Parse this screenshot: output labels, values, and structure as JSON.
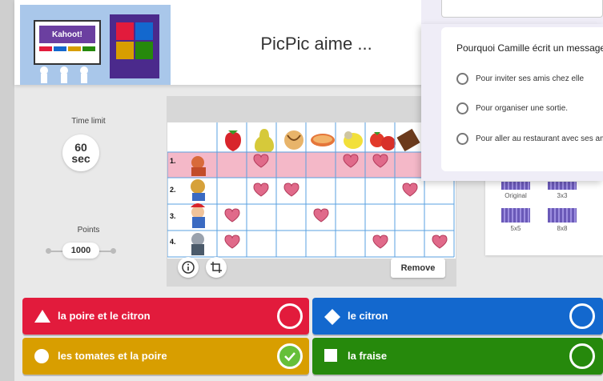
{
  "header": {
    "title": "PicPic aime ...",
    "cover_brand": "Kahoot!"
  },
  "settings": {
    "time_label": "Time limit",
    "time_value": "60",
    "time_unit": "sec",
    "points_label": "Points",
    "points_value": "1000"
  },
  "media": {
    "row_numbers": [
      "1.",
      "2.",
      "3.",
      "4."
    ],
    "remove_label": "Remove",
    "info_icon": "info-icon",
    "crop_icon": "crop-icon"
  },
  "crop_options": [
    "Original",
    "3x3",
    "5x5",
    "8x8"
  ],
  "popup": {
    "question": "Pourquoi Camille écrit un message ?",
    "options": [
      "Pour inviter ses amis chez elle",
      "Pour organiser une sortie.",
      "Pour aller au restaurant avec ses amis"
    ]
  },
  "answers": [
    {
      "label": "la poire et le citron",
      "shape": "triangle",
      "color": "#e21b3c",
      "correct": false
    },
    {
      "label": "le citron",
      "shape": "diamond",
      "color": "#1368ce",
      "correct": false
    },
    {
      "label": "les tomates et la poire",
      "shape": "circle",
      "color": "#d89e00",
      "correct": true
    },
    {
      "label": "la fraise",
      "shape": "square",
      "color": "#26890c",
      "correct": false
    }
  ]
}
